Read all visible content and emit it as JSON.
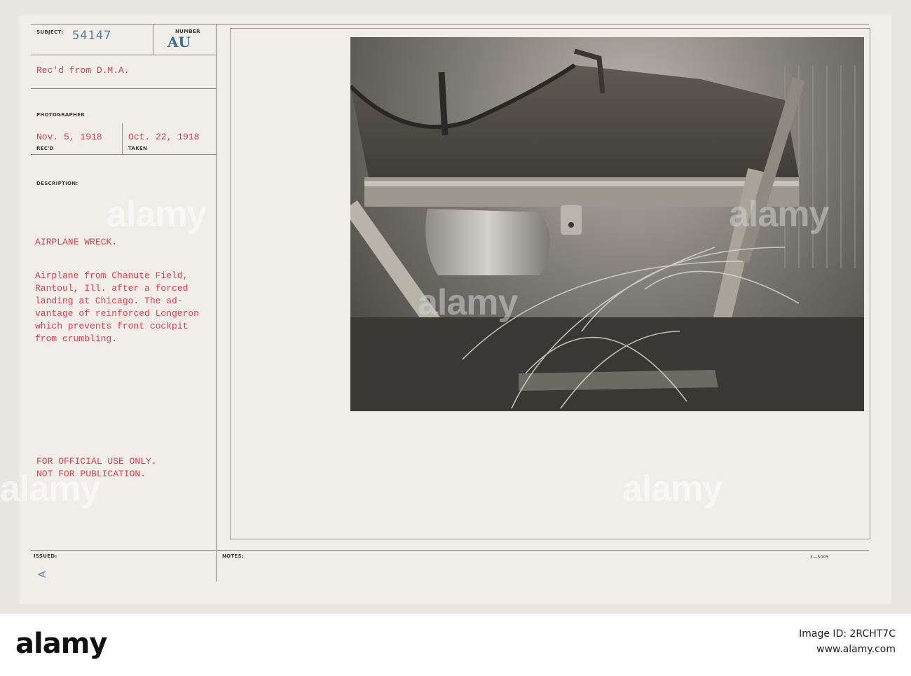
{
  "card": {
    "subject_label": "SUBJECT:",
    "subject_number": "54147",
    "number_label": "NUMBER",
    "number_stamp": "AU",
    "received_from": "Rec'd from D.M.A.",
    "photographer_label": "PHOTOGRAPHER",
    "recd_date": "Nov. 5, 1918",
    "recd_label": "REC'D",
    "taken_date": "Oct. 22, 1918",
    "taken_label": "TAKEN",
    "description_label": "DESCRIPTION:",
    "title": "AIRPLANE WRECK.",
    "description_lines": [
      "Airplane from Chanute Field,",
      "Rantoul, Ill. after a forced",
      "landing at Chicago. The ad-",
      "vantage of reinforced Longeron",
      "which prevents front cockpit",
      "from crumbling."
    ],
    "notice_lines": [
      "FOR OFFICIAL USE ONLY.",
      "NOT FOR PUBLICATION."
    ],
    "issued_label": "ISSUED:",
    "issued_mark": "A",
    "notes_label": "NOTES:",
    "form_number": "3—5005"
  },
  "watermark": "alamy",
  "footer": {
    "logo": "alamy",
    "image_id_label": "Image ID: 2RCHT7C",
    "site": "www.alamy.com"
  },
  "colors": {
    "typed_red": "#d8404c",
    "stamp_blue": "#3e6c95",
    "card_background": "#f1eeea"
  }
}
